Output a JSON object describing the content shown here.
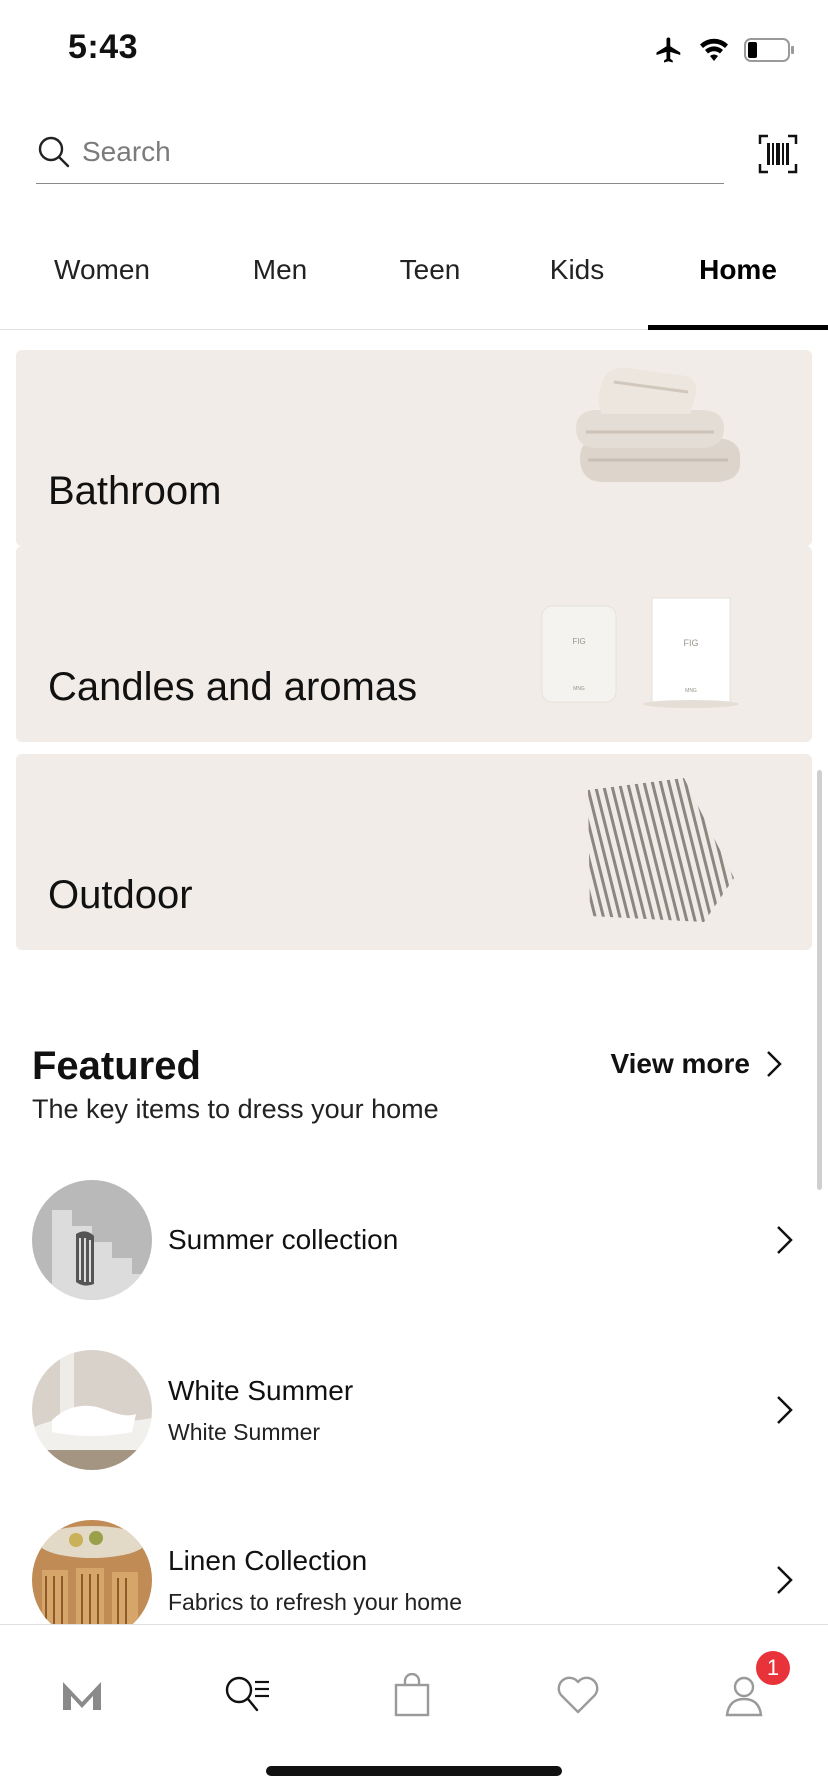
{
  "status_bar": {
    "time": "5:43"
  },
  "search": {
    "placeholder": "Search",
    "value": ""
  },
  "tabs": [
    {
      "label": "Women",
      "active": false
    },
    {
      "label": "Men",
      "active": false
    },
    {
      "label": "Teen",
      "active": false
    },
    {
      "label": "Kids",
      "active": false
    },
    {
      "label": "Home",
      "active": true
    }
  ],
  "categories": [
    {
      "label": "Bathroom"
    },
    {
      "label": "Candles and aromas"
    },
    {
      "label": "Outdoor"
    }
  ],
  "featured": {
    "title": "Featured",
    "subtitle": "The key items to dress your home",
    "view_more": "View more",
    "items": [
      {
        "title": "Summer collection",
        "desc": ""
      },
      {
        "title": "White Summer",
        "desc": "White Summer"
      },
      {
        "title": "Linen Collection",
        "desc": "Fabrics to refresh your home"
      }
    ]
  },
  "bottom_nav": {
    "profile_badge": "1"
  },
  "colors": {
    "card_bg": "#f1ece7",
    "badge": "#e8333a",
    "accent": "#000000"
  }
}
